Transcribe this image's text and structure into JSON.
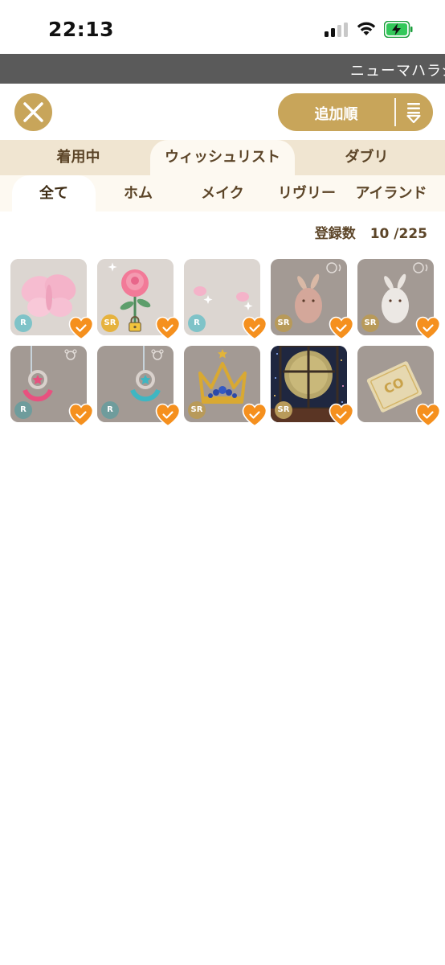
{
  "status_bar": {
    "time": "22:13"
  },
  "marquee": {
    "text": "ニューマハラジ"
  },
  "header": {
    "sort_label": "追加順"
  },
  "main_tabs": [
    {
      "label": "着用中",
      "active": false
    },
    {
      "label": "ウィッシュリスト",
      "active": true
    },
    {
      "label": "ダブリ",
      "active": false
    }
  ],
  "sub_tabs": [
    {
      "label": "全て",
      "active": true
    },
    {
      "label": "ホム",
      "active": false
    },
    {
      "label": "メイク",
      "active": false
    },
    {
      "label": "リヴリー",
      "active": false
    },
    {
      "label": "アイランド",
      "active": false
    }
  ],
  "registered": {
    "label": "登録数",
    "value": "10 /225"
  },
  "items": [
    {
      "name": "pink-butterfly-item",
      "rarity": "R",
      "locked": false,
      "wishlisted": true
    },
    {
      "name": "pink-rose-item",
      "rarity": "SR",
      "locked": true,
      "wishlisted": true
    },
    {
      "name": "pink-sparkle-item",
      "rarity": "R",
      "locked": false,
      "wishlisted": true
    },
    {
      "name": "pink-bunny-figure-item",
      "rarity": "SR",
      "locked": false,
      "wishlisted": true
    },
    {
      "name": "white-bunny-figure-item",
      "rarity": "SR",
      "locked": false,
      "wishlisted": true
    },
    {
      "name": "pink-star-necklace-item",
      "rarity": "R",
      "locked": false,
      "wishlisted": true
    },
    {
      "name": "blue-star-necklace-item",
      "rarity": "R",
      "locked": false,
      "wishlisted": true
    },
    {
      "name": "gold-crown-item",
      "rarity": "SR",
      "locked": false,
      "wishlisted": true
    },
    {
      "name": "moon-window-item",
      "rarity": "SR",
      "locked": false,
      "wishlisted": true
    },
    {
      "name": "ticket-item",
      "rarity": "",
      "locked": false,
      "wishlisted": true
    }
  ],
  "colors": {
    "gold": "#c8a55a",
    "tab_bg": "#f0e5d1",
    "tab_active": "#fdf9f1",
    "text_brown": "#5c4528",
    "rarity_r": "#7fc3c8",
    "rarity_sr": "#e6b23d",
    "heart": "#f5901e"
  }
}
